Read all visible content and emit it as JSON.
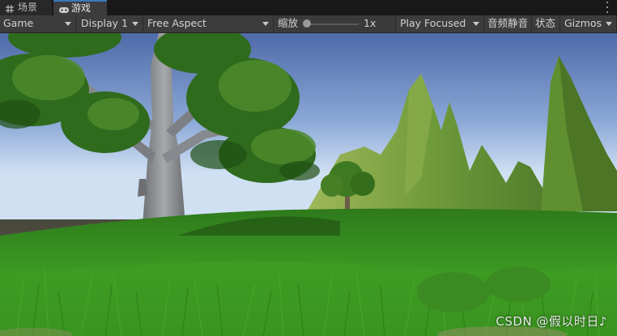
{
  "tabs": [
    {
      "label": "场景",
      "icon": "grid-icon",
      "active": false
    },
    {
      "label": "游戏",
      "icon": "gamepad-icon",
      "active": true
    }
  ],
  "toolbar": {
    "game_view": "Game",
    "display": "Display 1",
    "aspect": "Free Aspect",
    "scale_label": "缩放",
    "scale_value": "1x",
    "play_mode": "Play Focused",
    "mute_audio": "音频静音",
    "stats": "状态",
    "gizmos": "Gizmos"
  },
  "watermark": "CSDN @假以时日♪"
}
